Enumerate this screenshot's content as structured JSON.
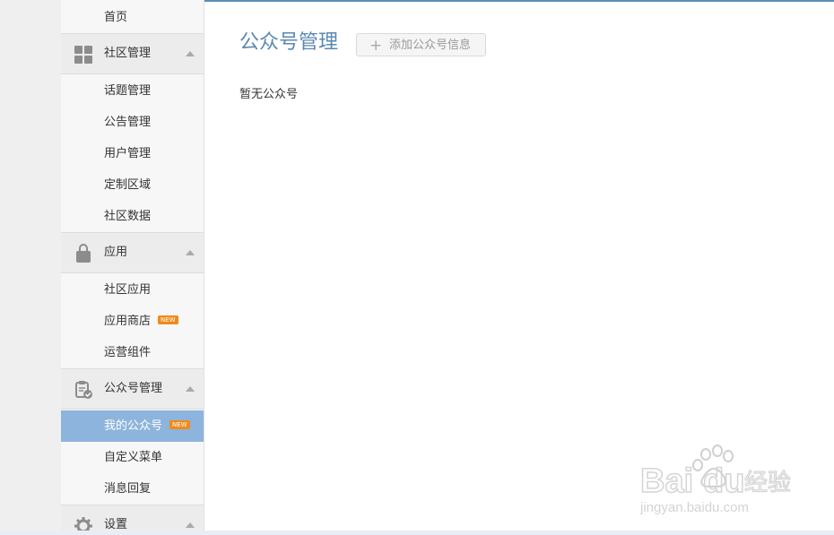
{
  "sidebar": {
    "home": "首页",
    "community": {
      "label": "社区管理",
      "items": [
        "话题管理",
        "公告管理",
        "用户管理",
        "定制区域",
        "社区数据"
      ]
    },
    "apps": {
      "label": "应用",
      "items": [
        "社区应用",
        "应用商店",
        "运营组件"
      ],
      "badge": "NEW"
    },
    "official": {
      "label": "公众号管理",
      "items": [
        "我的公众号",
        "自定义菜单",
        "消息回复"
      ],
      "badge": "NEW"
    },
    "settings": {
      "label": "设置"
    }
  },
  "main": {
    "title": "公众号管理",
    "add_button": "添加公众号信息",
    "empty_text": "暂无公众号"
  },
  "watermark": {
    "brand": "Baidu经验",
    "url": "jingyan.baidu.com"
  },
  "colors": {
    "accent": "#5a88b0",
    "active_bg": "#8db4dc",
    "badge": "#f08a1b"
  }
}
